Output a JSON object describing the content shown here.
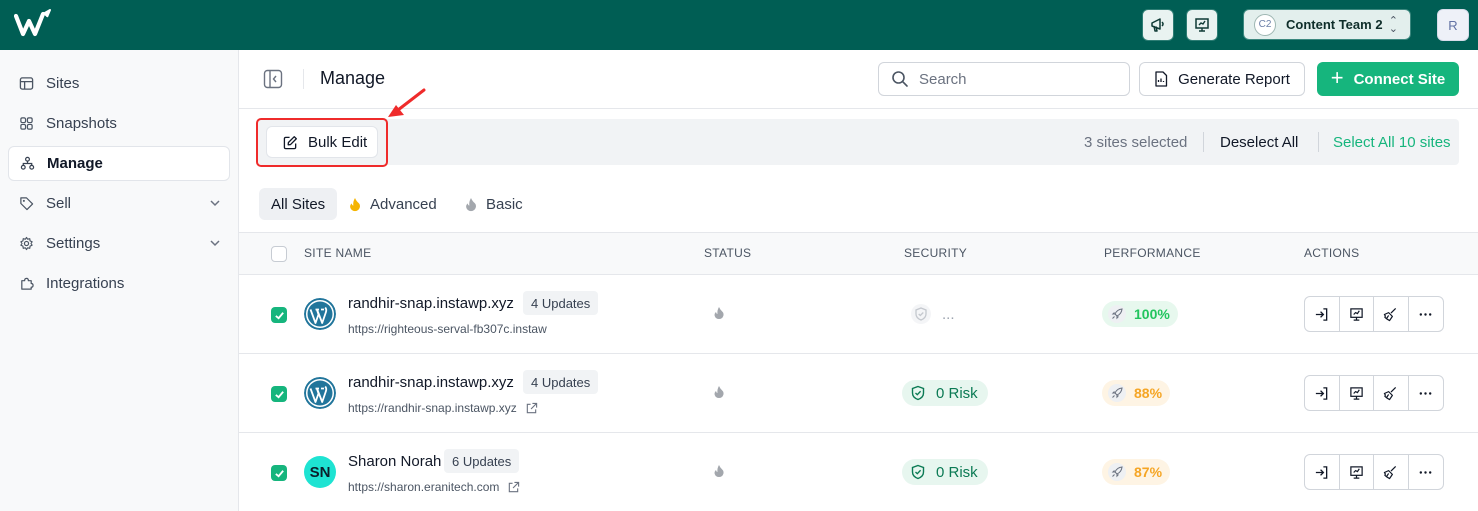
{
  "topbar": {
    "team_badge": "C2",
    "team_name": "Content Team 2",
    "user_initial": "R"
  },
  "sidebar": {
    "items": [
      {
        "label": "Sites",
        "icon": "table-icon"
      },
      {
        "label": "Snapshots",
        "icon": "grid-icon"
      },
      {
        "label": "Manage",
        "icon": "hierarchy-icon",
        "active": true
      },
      {
        "label": "Sell",
        "icon": "tag-icon",
        "expandable": true
      },
      {
        "label": "Settings",
        "icon": "gear-icon",
        "expandable": true
      },
      {
        "label": "Integrations",
        "icon": "puzzle-icon"
      }
    ]
  },
  "header": {
    "title": "Manage",
    "search_placeholder": "Search",
    "generate_report_label": "Generate Report",
    "connect_site_label": "Connect Site"
  },
  "bulk_bar": {
    "bulk_edit_label": "Bulk Edit",
    "selected_text": "3 sites selected",
    "deselect_label": "Deselect All",
    "select_all_label": "Select All 10 sites"
  },
  "tabs": [
    {
      "label": "All Sites",
      "active": true
    },
    {
      "label": "Advanced",
      "icon": "fire-icon",
      "color": "#f5b400"
    },
    {
      "label": "Basic",
      "icon": "fire-icon",
      "color": "#9ca3af"
    }
  ],
  "table": {
    "columns": [
      "SITE NAME",
      "STATUS",
      "SECURITY",
      "PERFORMANCE",
      "ACTIONS"
    ],
    "rows": [
      {
        "checked": true,
        "icon": "wordpress-icon",
        "name": "randhir-snap.instawp.xyz",
        "updates": "4 Updates",
        "url": "https://righteous-serval-fb307c.instaw",
        "security": "...",
        "performance": "100%",
        "performance_color": "green"
      },
      {
        "checked": true,
        "icon": "wordpress-icon",
        "name": "randhir-snap.instawp.xyz",
        "updates": "4 Updates",
        "url": "https://randhir-snap.instawp.xyz",
        "security": "0 Risk",
        "performance": "88%",
        "performance_color": "orange"
      },
      {
        "checked": true,
        "icon": "sn-avatar",
        "initials": "SN",
        "name": "Sharon Norah",
        "updates": "6 Updates",
        "url": "https://sharon.eranitech.com",
        "security": "0 Risk",
        "performance": "87%",
        "performance_color": "orange"
      }
    ]
  },
  "colors": {
    "topbar": "#005e54",
    "accent": "#16b57d",
    "highlight": "#ef2b2b"
  }
}
